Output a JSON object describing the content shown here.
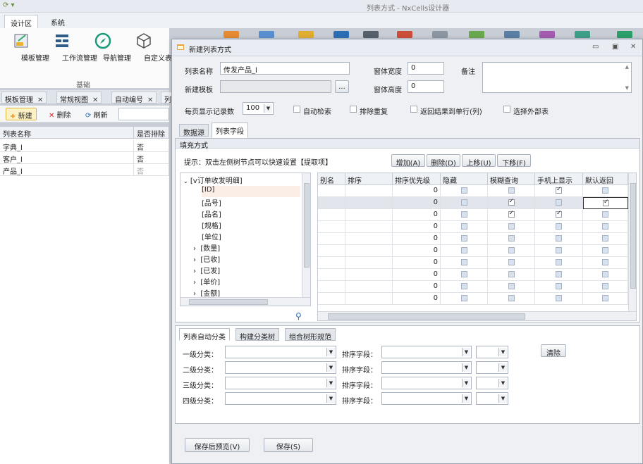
{
  "app": {
    "title": "列表方式 - NxCells设计器",
    "quick_access": "⟳ ▾",
    "ribbon_tabs": [
      "设计区",
      "系统"
    ],
    "ribbon_buttons": [
      "模板管理",
      "工作流管理",
      "导航管理",
      "自定义表单"
    ],
    "ribbon_group": "基础",
    "doc_tabs": [
      "模板管理",
      "常规视图",
      "自动编号",
      "列"
    ],
    "toolbar": {
      "new": "新建",
      "delete": "删除",
      "refresh": "刷新"
    },
    "list": {
      "headers": [
        "列表名称",
        "是否排除"
      ],
      "rows": [
        [
          "字典_l",
          "否"
        ],
        [
          "客户_l",
          "否"
        ],
        [
          "产品_l",
          "否"
        ]
      ]
    }
  },
  "dialog": {
    "title": "新建列表方式",
    "controls": {
      "minimize": "▭",
      "maximize": "▣",
      "close": "✕"
    },
    "fields": {
      "list_name_label": "列表名称",
      "list_name_value": "传发产品_l",
      "template_label": "新建模板",
      "template_value": "",
      "browse": "...",
      "width_label": "窗体宽度",
      "width_value": "0",
      "height_label": "窗体高度",
      "height_value": "0",
      "remark_label": "备注",
      "per_page_label": "每页显示记录数",
      "per_page_value": "100"
    },
    "options": [
      "自动检索",
      "排除重复",
      "返回结果到单行(列)",
      "选择外部表"
    ],
    "tabs": [
      "数据源",
      "列表字段"
    ],
    "fill": {
      "header": "填充方式",
      "hint": "提示：双击左侧树节点可以快速设置【提取项】",
      "buttons": [
        "增加(A)",
        "删除(D)",
        "上移(U)",
        "下移(F)"
      ]
    },
    "tree": {
      "root": "[v订单收发明细]",
      "nodes": [
        "[ID]",
        "[品号]",
        "[品名]",
        "[规格]",
        "[单位]",
        "[数量]",
        "[已收]",
        "[已发]",
        "[单价]",
        "[金额]"
      ]
    },
    "grid": {
      "headers": [
        "别名",
        "排序",
        "排序优先级",
        "隐藏",
        "模糊查询",
        "手机上显示",
        "默认返回"
      ],
      "priority": [
        "0",
        "0",
        "0",
        "0",
        "0",
        "0",
        "0",
        "0",
        "0",
        "0"
      ],
      "checks": [
        [
          false,
          false,
          true,
          false
        ],
        [
          false,
          true,
          false,
          true
        ],
        [
          false,
          true,
          true,
          false
        ],
        [
          false,
          false,
          false,
          false
        ],
        [
          false,
          false,
          false,
          false
        ],
        [
          false,
          false,
          false,
          false
        ],
        [
          false,
          false,
          false,
          false
        ],
        [
          false,
          false,
          false,
          false
        ],
        [
          false,
          false,
          false,
          false
        ],
        [
          false,
          false,
          false,
          false
        ]
      ]
    },
    "bottom_tabs": [
      "列表自动分类",
      "构建分类树",
      "组合树形规范"
    ],
    "categories": {
      "levels": [
        "一级分类：",
        "二级分类：",
        "三级分类：",
        "四级分类："
      ],
      "sort_label": "排序字段：",
      "clear": "清除"
    },
    "footer": {
      "save_preview": "保存后预览(V)",
      "save": "保存(S)"
    }
  }
}
